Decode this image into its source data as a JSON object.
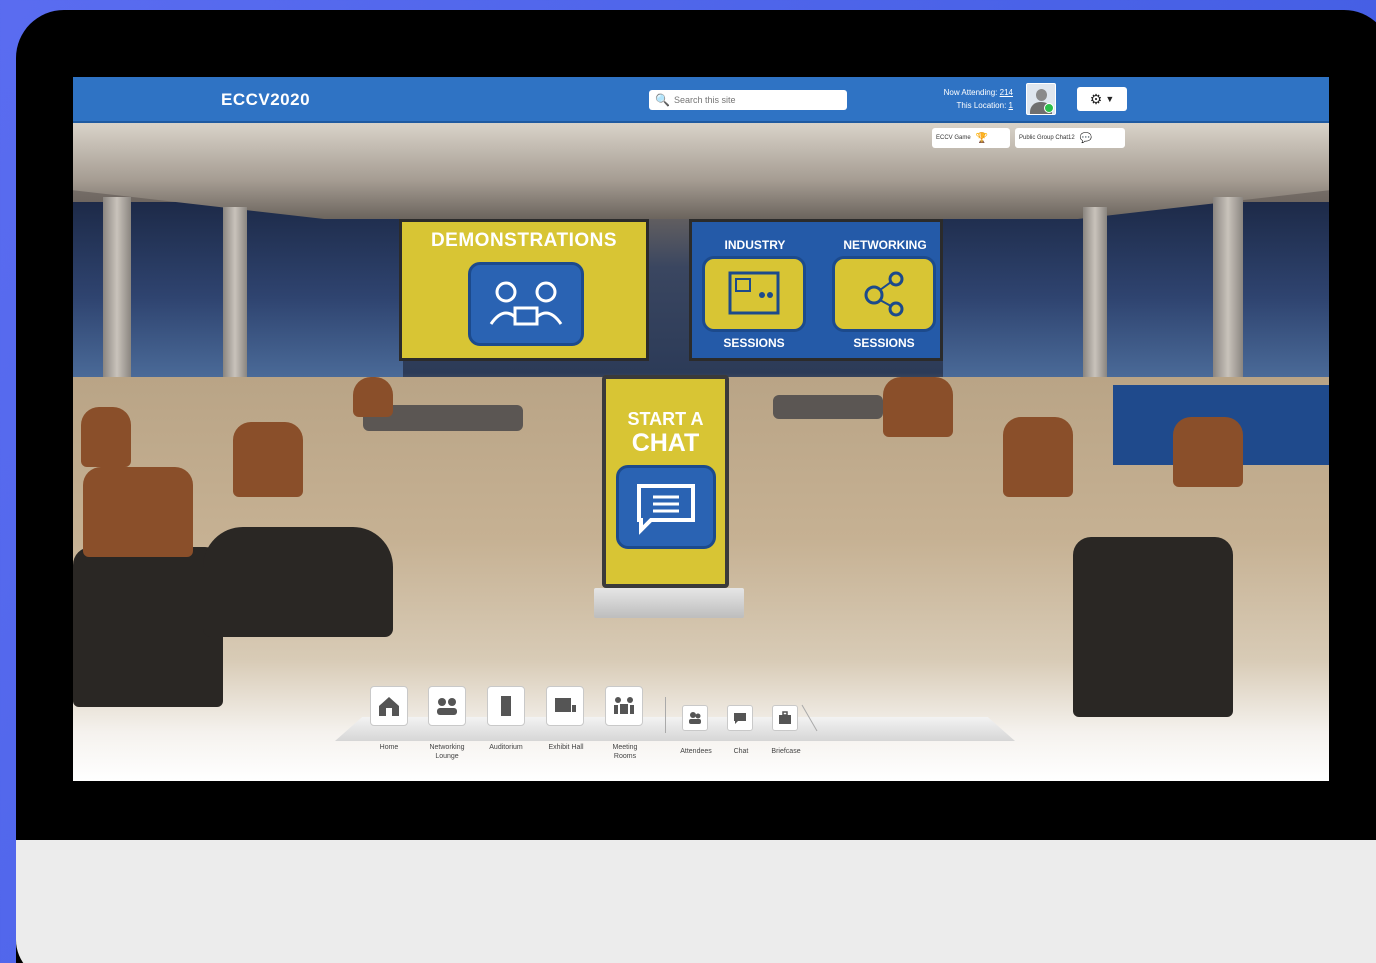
{
  "header": {
    "brand": "ECCV2020",
    "search_placeholder": "Search this site",
    "now_attending_label": "Now Attending:",
    "now_attending_value": "214",
    "this_location_label": "This Location:",
    "this_location_value": "1"
  },
  "sub_buttons": {
    "games_label": "ECCV Game",
    "public_chat_label": "Public Group Chat12"
  },
  "banners": {
    "demonstrations": "DEMONSTRATIONS",
    "industry": "INDUSTRY",
    "networking": "NETWORKING",
    "industry_sessions": "SESSIONS",
    "networking_sessions": "SESSIONS"
  },
  "kiosk": {
    "line1": "START A",
    "line2": "CHAT"
  },
  "dock": {
    "items": [
      {
        "label": "Home",
        "icon": "house-icon"
      },
      {
        "label": "Networking Lounge",
        "icon": "people-icon"
      },
      {
        "label": "Auditorium",
        "icon": "door-icon"
      },
      {
        "label": "Exhibit Hall",
        "icon": "booth-icon"
      },
      {
        "label": "Meeting Rooms",
        "icon": "meeting-icon"
      }
    ],
    "secondary": [
      {
        "label": "Attendees",
        "icon": "attendees-icon"
      },
      {
        "label": "Chat",
        "icon": "chat-icon"
      },
      {
        "label": "Briefcase",
        "icon": "briefcase-icon"
      }
    ]
  },
  "colors": {
    "topbar": "#2f73c4",
    "accent_yellow": "#d8c534",
    "accent_blue": "#245aa8",
    "page_bg": "#4b63e8"
  }
}
